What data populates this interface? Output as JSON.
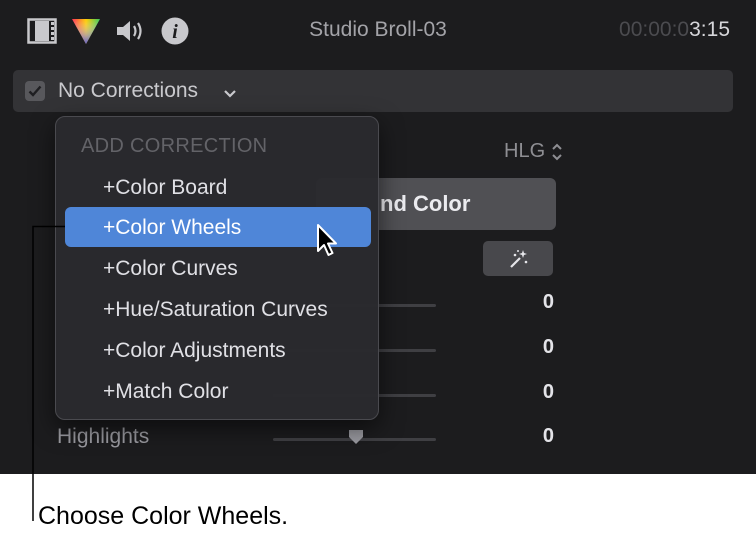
{
  "header": {
    "clip_name": "Studio Broll-03",
    "timecode_dim": "00:00:0",
    "timecode_lit": "3:15",
    "icons": [
      "film-icon",
      "color-prism-icon",
      "audio-icon",
      "info-icon"
    ]
  },
  "correction_bar": {
    "checked": true,
    "label": "No Corrections"
  },
  "inspector": {
    "color_space": "HLG",
    "balance_button_label": "nd Color",
    "rows": [
      {
        "label": "",
        "value": "0"
      },
      {
        "label": "",
        "value": "0"
      },
      {
        "label": "",
        "value": "0"
      },
      {
        "label": "Highlights",
        "value": "0"
      }
    ]
  },
  "menu": {
    "header": "ADD CORRECTION",
    "items": [
      {
        "label": "+Color Board",
        "selected": false
      },
      {
        "label": "+Color Wheels",
        "selected": true
      },
      {
        "label": "+Color Curves",
        "selected": false
      },
      {
        "label": "+Hue/Saturation Curves",
        "selected": false
      },
      {
        "label": "+Color Adjustments",
        "selected": false
      },
      {
        "label": "+Match Color",
        "selected": false
      }
    ]
  },
  "caption": "Choose Color Wheels.",
  "colors": {
    "background": "#1c1c1e",
    "menu_highlight": "#4f86d8"
  }
}
